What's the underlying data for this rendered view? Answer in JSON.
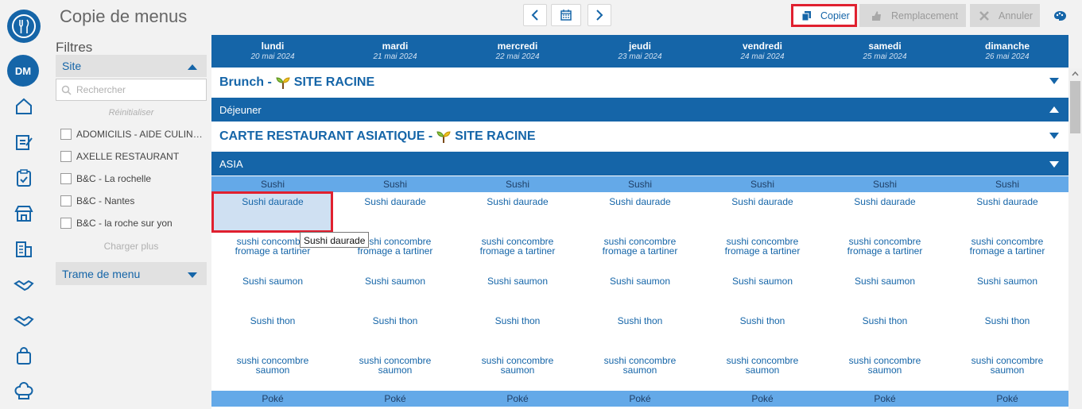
{
  "header": {
    "title": "Copie de menus",
    "copy_label": "Copier",
    "replace_label": "Remplacement",
    "cancel_label": "Annuler"
  },
  "rail": {
    "avatar_initials": "DM"
  },
  "filters": {
    "title": "Filtres",
    "site_panel": "Site",
    "search_placeholder": "Rechercher",
    "reset_label": "Réinitialiser",
    "load_more_label": "Charger plus",
    "sites": [
      "ADOMICILIS - AIDE CULINAIRE",
      "AXELLE RESTAURANT",
      "B&C - La rochelle",
      "B&C - Nantes",
      "B&C - la roche sur yon"
    ],
    "menu_frame_panel": "Trame de menu"
  },
  "week": {
    "days": [
      {
        "name": "lundi",
        "date": "20 mai 2024"
      },
      {
        "name": "mardi",
        "date": "21 mai 2024"
      },
      {
        "name": "mercredi",
        "date": "22 mai 2024"
      },
      {
        "name": "jeudi",
        "date": "23 mai 2024"
      },
      {
        "name": "vendredi",
        "date": "24 mai 2024"
      },
      {
        "name": "samedi",
        "date": "25 mai 2024"
      },
      {
        "name": "dimanche",
        "date": "26 mai 2024"
      }
    ]
  },
  "sections": {
    "brunch_title": "Brunch -",
    "brunch_site": "SITE RACINE",
    "lunch_band": "Déjeuner",
    "carte_title": "CARTE RESTAURANT ASIATIQUE -",
    "carte_site": "SITE RACINE",
    "asia_band": "ASIA",
    "sushi_label": "Sushi",
    "poke_label": "Poké"
  },
  "dishes": {
    "d1": "Sushi daurade",
    "d2a": "sushi concombre",
    "d2b": "fromage a tartiner",
    "d3": "Sushi saumon",
    "d4": "Sushi thon",
    "d5a": "sushi concombre",
    "d5b": "saumon"
  },
  "tooltip": "Sushi daurade",
  "colors": {
    "primary": "#1565a8",
    "sub_band": "#64a9e8",
    "highlight": "#e0202f",
    "selected_cell": "#cfe0f2"
  }
}
